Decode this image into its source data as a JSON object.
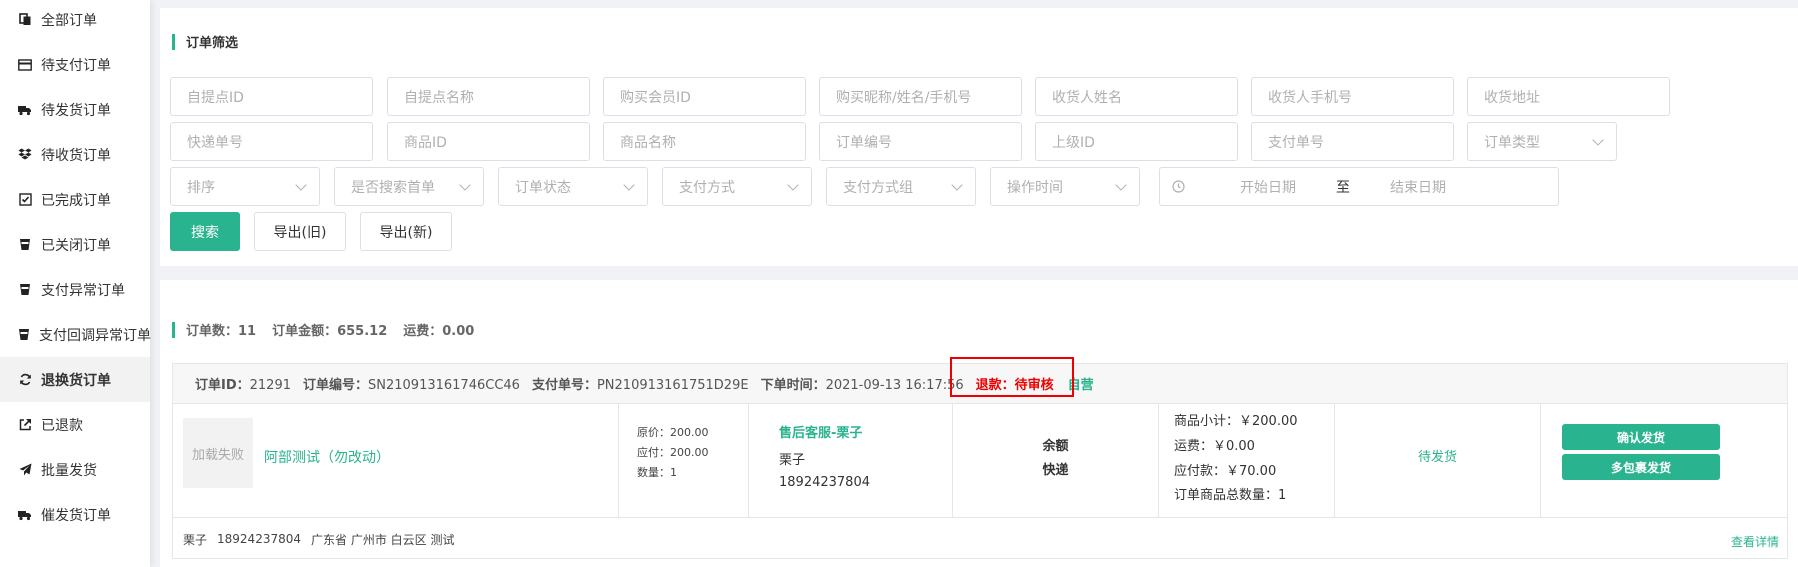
{
  "sidebar": {
    "items": [
      {
        "label": "全部订单",
        "icon": "copy-icon"
      },
      {
        "label": "待支付订单",
        "icon": "credit-card-icon"
      },
      {
        "label": "待发货订单",
        "icon": "truck-icon"
      },
      {
        "label": "待收货订单",
        "icon": "dropbox-icon"
      },
      {
        "label": "已完成订单",
        "icon": "check-square-icon"
      },
      {
        "label": "已关闭订单",
        "icon": "cup-icon"
      },
      {
        "label": "支付异常订单",
        "icon": "cup-icon"
      },
      {
        "label": "支付回调异常订单",
        "icon": "cup-icon"
      },
      {
        "label": "退换货订单",
        "icon": "refresh-icon"
      },
      {
        "label": "已退款",
        "icon": "share-square-icon"
      },
      {
        "label": "批量发货",
        "icon": "paper-plane-icon"
      },
      {
        "label": "催发货订单",
        "icon": "truck-icon"
      }
    ],
    "active_index": 8
  },
  "filter": {
    "title": "订单筛选",
    "row1": [
      "自提点ID",
      "自提点名称",
      "购买会员ID",
      "购买昵称/姓名/手机号",
      "收货人姓名",
      "收货人手机号",
      "收货地址"
    ],
    "row2": [
      "快递单号",
      "商品ID",
      "商品名称",
      "订单编号",
      "上级ID",
      "支付单号"
    ],
    "order_type": "订单类型",
    "selects": [
      "排序",
      "是否搜索首单",
      "订单状态",
      "支付方式",
      "支付方式组",
      "操作时间"
    ],
    "date": {
      "start": "开始日期",
      "sep": "至",
      "end": "结束日期"
    },
    "buttons": {
      "search": "搜索",
      "export_old": "导出(旧)",
      "export_new": "导出(新)"
    }
  },
  "summary": {
    "count": "订单数：11",
    "amount": "订单金额：655.12",
    "freight": "运费：0.00"
  },
  "order": {
    "id_label": "订单ID：",
    "id": "21291",
    "no_label": "订单编号：",
    "no": "SN210913161746CC46",
    "pay_label": "支付单号：",
    "pay": "PN210913161751D29E",
    "time_label": "下单时间：",
    "time": "2021-09-13 16:17:56",
    "refund": "退款：待审核",
    "self": "自营",
    "thumb": "加载失败",
    "goods_name": "阿部测试（勿改动）",
    "price_orig": "原价：200.00",
    "price_due": "应付：200.00",
    "qty": "数量：1",
    "service": "售后客服-栗子",
    "customer": "栗子",
    "phone": "18924237804",
    "pay_method": "余额",
    "ship_method": "快递",
    "subtotal": "商品小计：￥200.00",
    "freight": "运费：￥0.00",
    "payable": "应付款：￥70.00",
    "total_qty": "订单商品总数量：1",
    "status": "待发货",
    "btn_confirm": "确认发货",
    "btn_multi": "多包裹发货",
    "foot_name": "栗子",
    "foot_phone": "18924237804",
    "foot_addr": "广东省 广州市 白云区 测试",
    "detail": "查看详情"
  }
}
